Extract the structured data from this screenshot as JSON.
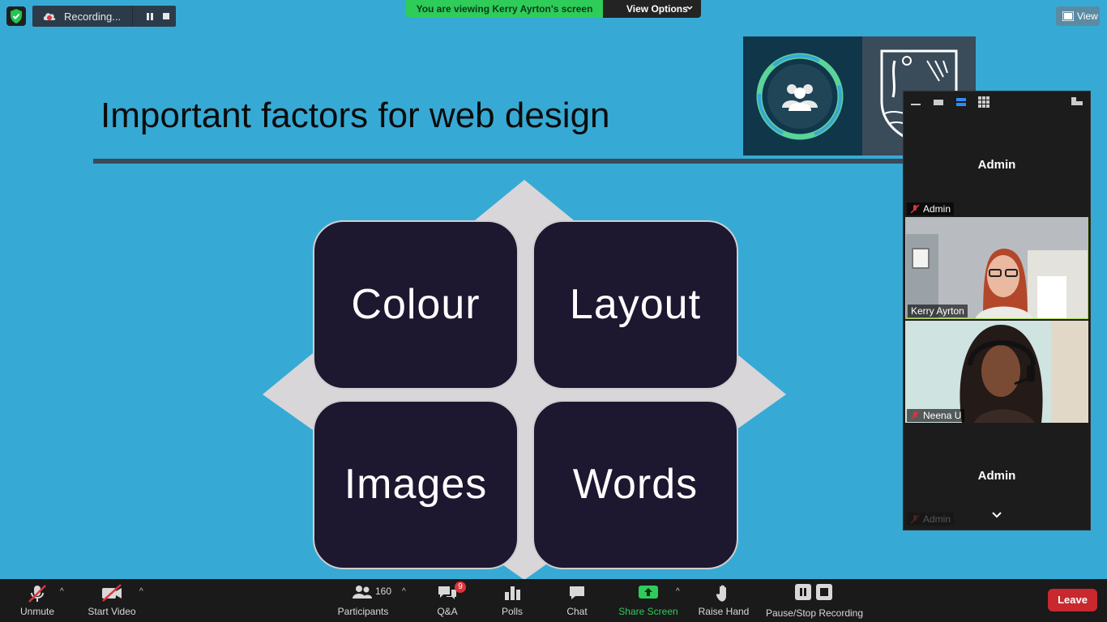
{
  "top": {
    "recording_label": "Recording...",
    "viewing_banner": "You are viewing Kerry Ayrton's screen",
    "view_options_label": "View Options",
    "view_label": "View"
  },
  "slide": {
    "title": "Important factors for web design",
    "tiles": [
      "Colour",
      "Layout",
      "Images",
      "Words"
    ]
  },
  "participants_panel": {
    "tiles": [
      {
        "name": "Admin",
        "label": "Admin",
        "type": "name-only",
        "muted": true
      },
      {
        "name": "Kerry Ayrton",
        "label": "Kerry Ayrton",
        "type": "video",
        "muted": false,
        "active_speaker": true
      },
      {
        "name": "Neena U",
        "label": "Neena U",
        "type": "video",
        "muted": true
      },
      {
        "name": "Admin",
        "label": "Admin",
        "type": "name-only",
        "muted": true
      }
    ]
  },
  "toolbar": {
    "unmute": "Unmute",
    "start_video": "Start Video",
    "participants": "Participants",
    "participants_count": "160",
    "qa": "Q&A",
    "qa_badge": "9",
    "polls": "Polls",
    "chat": "Chat",
    "share_screen": "Share Screen",
    "raise_hand": "Raise Hand",
    "pause_stop_recording": "Pause/Stop Recording",
    "leave": "Leave"
  },
  "colors": {
    "slide_bg": "#36aad5",
    "viewing_banner": "#2ecc59",
    "share_screen": "#2ecc59",
    "leave": "#c8282e",
    "tile_bg": "#1e1730"
  }
}
